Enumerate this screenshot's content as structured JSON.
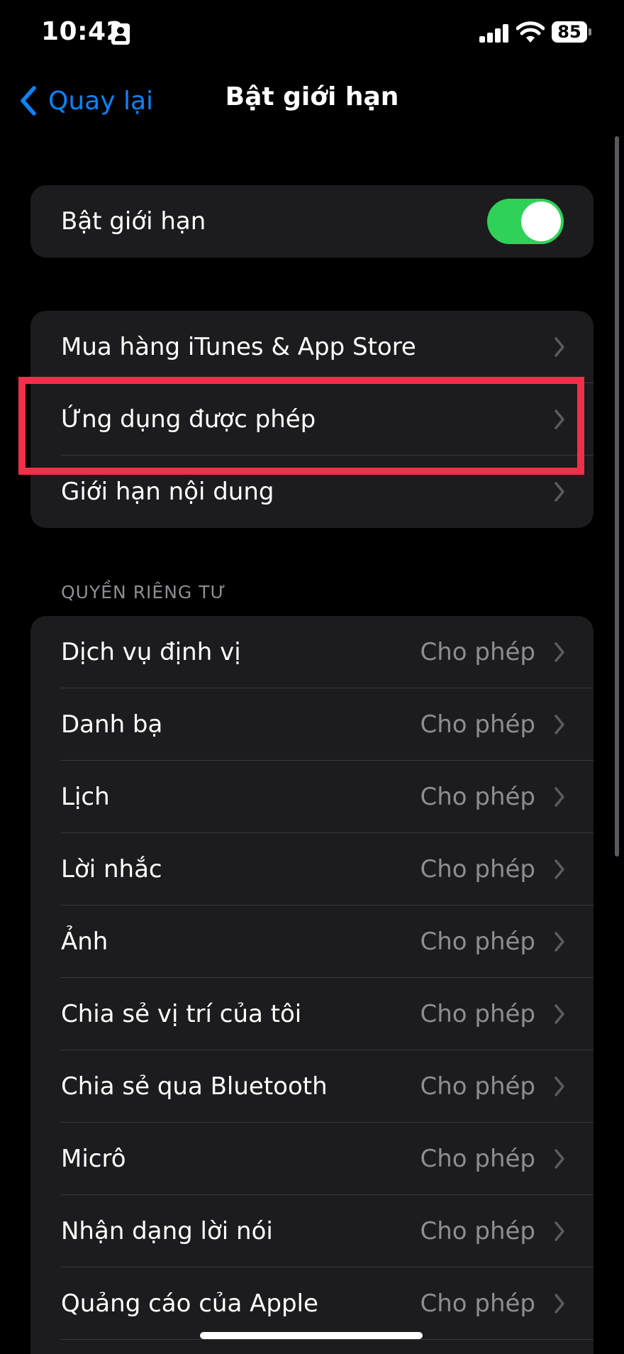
{
  "status_bar": {
    "time": "10:42",
    "battery_level": "85"
  },
  "nav": {
    "back_label": "Quay lại",
    "title": "Bật giới hạn"
  },
  "restrictions_toggle": {
    "label": "Bật giới hạn",
    "enabled": true
  },
  "main_group": {
    "items": [
      {
        "label": "Mua hàng iTunes & App Store"
      },
      {
        "label": "Ứng dụng được phép"
      },
      {
        "label": "Giới hạn nội dung"
      }
    ]
  },
  "privacy": {
    "header": "QUYỀN RIÊNG TƯ",
    "items": [
      {
        "label": "Dịch vụ định vị",
        "value": "Cho phép"
      },
      {
        "label": "Danh bạ",
        "value": "Cho phép"
      },
      {
        "label": "Lịch",
        "value": "Cho phép"
      },
      {
        "label": "Lời nhắc",
        "value": "Cho phép"
      },
      {
        "label": "Ảnh",
        "value": "Cho phép"
      },
      {
        "label": "Chia sẻ vị trí của tôi",
        "value": "Cho phép"
      },
      {
        "label": "Chia sẻ qua Bluetooth",
        "value": "Cho phép"
      },
      {
        "label": "Micrô",
        "value": "Cho phép"
      },
      {
        "label": "Nhận dạng lời nói",
        "value": "Cho phép"
      },
      {
        "label": "Quảng cáo của Apple",
        "value": "Cho phép"
      }
    ]
  },
  "colors": {
    "accent": "#0a84ff",
    "toggle_on": "#30d158",
    "highlight": "#f0304a",
    "cell_background": "#1c1c1e"
  }
}
